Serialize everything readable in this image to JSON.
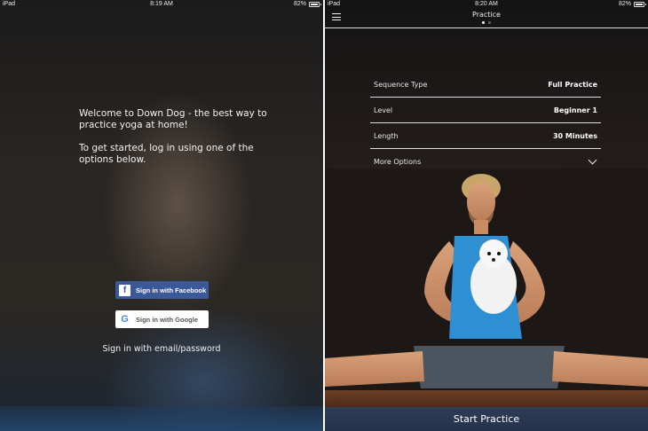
{
  "left_status": {
    "carrier": "iPad",
    "time": "8:19 AM",
    "battery": "82%"
  },
  "right_status": {
    "carrier": "iPad",
    "time": "8:20 AM",
    "battery": "82%"
  },
  "login": {
    "welcome_line1": "Welcome to Down Dog - the best way to practice yoga at home!",
    "welcome_line2": "To get started, log in using one of the options below.",
    "facebook_label": "Sign in with Facebook",
    "google_label": "Sign in with Google",
    "email_label": "Sign in with email/password"
  },
  "practice": {
    "title": "Practice",
    "page_dots": {
      "count": 2,
      "active_index": 0
    },
    "settings": [
      {
        "label": "Sequence Type",
        "value": "Full Practice"
      },
      {
        "label": "Level",
        "value": "Beginner 1"
      },
      {
        "label": "Length",
        "value": "30 Minutes"
      },
      {
        "label": "More Options",
        "value": ""
      }
    ],
    "start_label": "Start Practice"
  },
  "colors": {
    "facebook_blue": "#3b5998",
    "start_button": "#2e3c56"
  }
}
